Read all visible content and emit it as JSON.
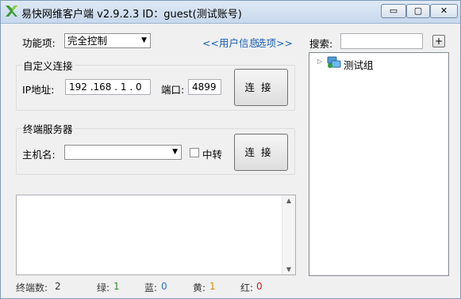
{
  "window": {
    "title": "易快网维客户端 v2.9.2.3  ID：guest(测试账号)",
    "controls": {
      "minimize": "▭",
      "maximize": "▢",
      "close": "✕"
    }
  },
  "top": {
    "function_label": "功能项:",
    "function_value": "完全控制",
    "user_info_link": "<<用户信息",
    "options_link": "选项>>"
  },
  "custom_connect": {
    "group_title": "自定义连接",
    "ip_label": "IP地址:",
    "ip_value": "192 .168 . 1  . 0",
    "port_label": "端口:",
    "port_value": "4899",
    "connect_label": "连接"
  },
  "terminal_server": {
    "group_title": "终端服务器",
    "host_label": "主机名:",
    "host_value": "",
    "relay_label": "中转",
    "connect_label": "连接"
  },
  "search": {
    "label": "搜索:",
    "value": "",
    "add_label": "+"
  },
  "tree": {
    "items": [
      {
        "label": "测试组",
        "expanded": false
      }
    ]
  },
  "status": {
    "terminal_label": "终端数:",
    "terminal_count": "2",
    "green_label": "绿:",
    "green_count": "1",
    "blue_label": "蓝:",
    "blue_count": "0",
    "yellow_label": "黄:",
    "yellow_count": "1",
    "red_label": "红:",
    "red_count": "0"
  },
  "colors": {
    "link": "#1a5fb4",
    "green": "#2e8b2e",
    "blue": "#2a6fc9",
    "yellow": "#d98a00",
    "red": "#d02020"
  }
}
